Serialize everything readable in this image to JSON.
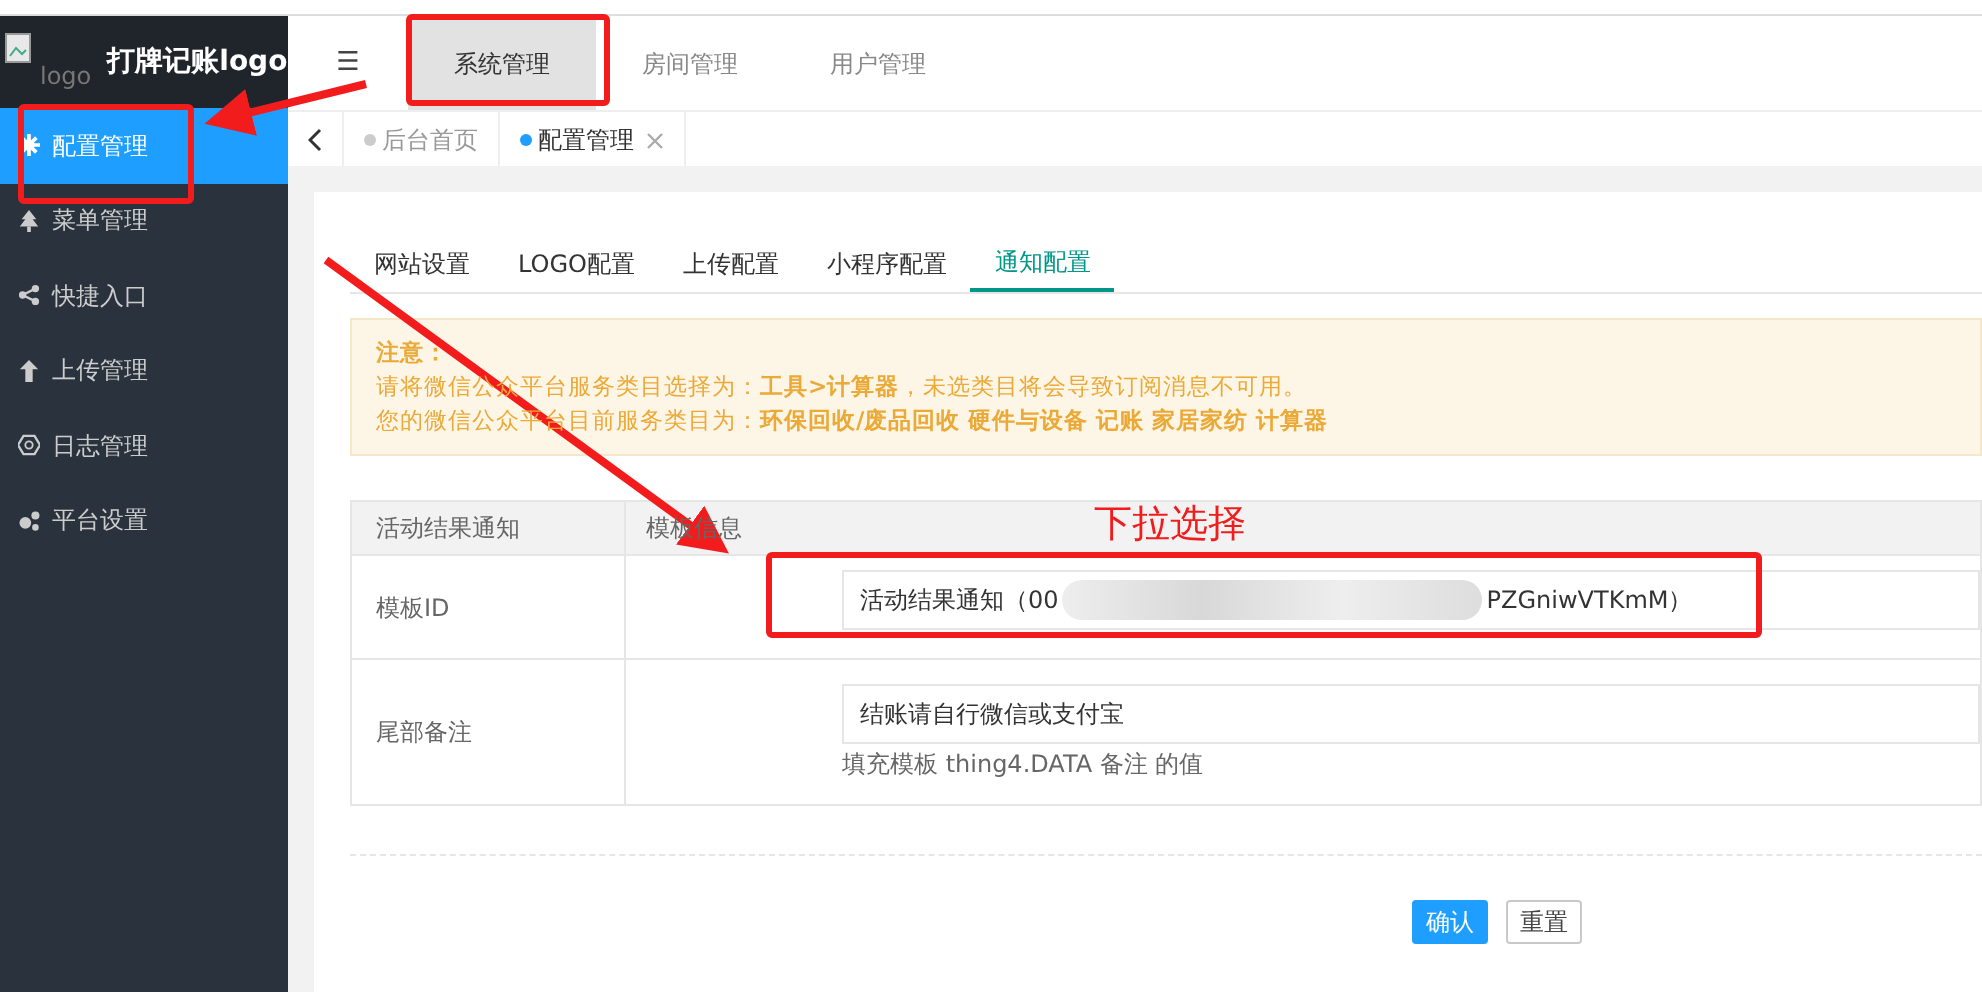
{
  "sidebar": {
    "logo_alt": "logo",
    "brand": "打牌记账logo",
    "items": [
      {
        "label": "配置管理",
        "selected": true
      },
      {
        "label": "菜单管理",
        "selected": false
      },
      {
        "label": "快捷入口",
        "selected": false
      },
      {
        "label": "上传管理",
        "selected": false
      },
      {
        "label": "日志管理",
        "selected": false
      },
      {
        "label": "平台设置",
        "selected": false
      }
    ]
  },
  "header": {
    "menu_icon": "☰",
    "tabs": [
      {
        "label": "系统管理",
        "selected": true
      },
      {
        "label": "房间管理",
        "selected": false
      },
      {
        "label": "用户管理",
        "selected": false
      }
    ]
  },
  "page_tabs": [
    {
      "label": "后台首页",
      "selected": false,
      "closable": false
    },
    {
      "label": "配置管理",
      "selected": true,
      "closable": true
    }
  ],
  "config_tabs": [
    {
      "label": "网站设置",
      "selected": false
    },
    {
      "label": "LOGO配置",
      "selected": false
    },
    {
      "label": "上传配置",
      "selected": false
    },
    {
      "label": "小程序配置",
      "selected": false
    },
    {
      "label": "通知配置",
      "selected": true
    }
  ],
  "notice": {
    "title": "注意：",
    "lines": [
      "请将微信公众平台服务类目选择为：**工具>计算器**，未选类目将会导致订阅消息不可用。",
      "您的微信公众平台目前服务类目为：**环保回收/废品回收 硬件与设备 记账 家居家纺 计算器**"
    ]
  },
  "table": {
    "columns": [
      "活动结果通知",
      "模板信息"
    ],
    "rows": [
      {
        "label": "模板ID",
        "kind": "select",
        "value_start": "活动结果通知（00",
        "value_end": "PZGniwVTKmM）"
      },
      {
        "label": "尾部备注",
        "kind": "input",
        "value": "结账请自行微信或支付宝",
        "help": "填充模板 thing4.DATA 备注 的值"
      }
    ]
  },
  "buttons": [
    {
      "label": "确认",
      "kind": "primary"
    },
    {
      "label": "重置",
      "kind": "default"
    }
  ],
  "annotation": {
    "label": "下拉选择"
  }
}
